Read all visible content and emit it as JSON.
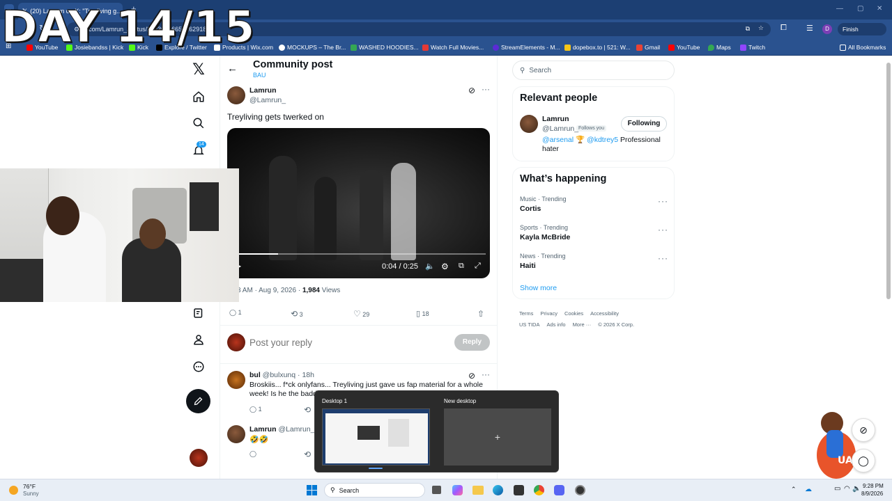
{
  "overlay": {
    "day_text": "DAY 14/15"
  },
  "browser": {
    "tab_title": "(20) Lamrun on X: \"Treyliving g...",
    "url": "x.com/Lamrun_/status/20830516656162918",
    "finish_update": "Finish update",
    "profile_initial": "D",
    "bookmarks": [
      "YouTube",
      "Josiebandss | Kick",
      "Kick",
      "Explore / Twitter",
      "Products | Wix.com",
      "MOCKUPS – The Br...",
      "WASHED HOODIES...",
      "Watch Full Movies...",
      "StreamElements - M...",
      "dopebox.to | 521: W...",
      "Gmail",
      "YouTube",
      "Maps",
      "Twitch"
    ],
    "all_bookmarks": "All Bookmarks"
  },
  "nav": {
    "notif_count": "14"
  },
  "post": {
    "header_title": "Community post",
    "community": "BAU",
    "author_name": "Lamrun",
    "author_handle": "@Lamrun_",
    "text": "Treyliving gets twerked on",
    "video_time": "0:04 / 0:25",
    "video_progress": 0.16,
    "meta_time": "3 AM · Aug 9, 2026 · ",
    "meta_views_count": "1,984",
    "meta_views_label": " Views",
    "stats": {
      "replies": "1",
      "reposts": "3",
      "likes": "29",
      "bookmarks": "18"
    },
    "reply_placeholder": "Post your reply",
    "reply_button": "Reply"
  },
  "replies": [
    {
      "name": "bul",
      "handle": "@bulxunq · 18h",
      "text": "Broskiis... f*ck onlyfans... Treyliving just gave us fap material for a whole week! Is he the badd",
      "replies": "1"
    },
    {
      "name": "Lamrun",
      "handle": "@Lamrun_ ·",
      "text": "🤣🤣"
    }
  ],
  "right": {
    "search_placeholder": "Search",
    "relevant_title": "Relevant people",
    "person_name": "Lamrun",
    "person_handle": "@Lamrun_",
    "follows_you": "Follows you",
    "following_btn": "Following",
    "bio_link1": "@arsenal",
    "bio_trophy": "🏆",
    "bio_link2": "@kdtrey5",
    "bio_rest": "Professional hater",
    "happening_title": "What’s happening",
    "trends": [
      {
        "category": "Music · Trending",
        "name": "Cortis"
      },
      {
        "category": "Sports · Trending",
        "name": "Kayla McBride"
      },
      {
        "category": "News · Trending",
        "name": "Haiti"
      }
    ],
    "show_more": "Show more",
    "footer_row1": [
      "Terms",
      "Privacy",
      "Cookies",
      "Accessibility"
    ],
    "footer_row2": [
      "US TIDA",
      "Ads info",
      "More ···",
      "© 2026 X Corp."
    ]
  },
  "desktops": {
    "desktop1": "Desktop 1",
    "new_desktop": "New desktop"
  },
  "taskbar": {
    "temp": "76°F",
    "weather": "Sunny",
    "search": "Search",
    "time": "9:28 PM",
    "date": "8/9/2026"
  }
}
